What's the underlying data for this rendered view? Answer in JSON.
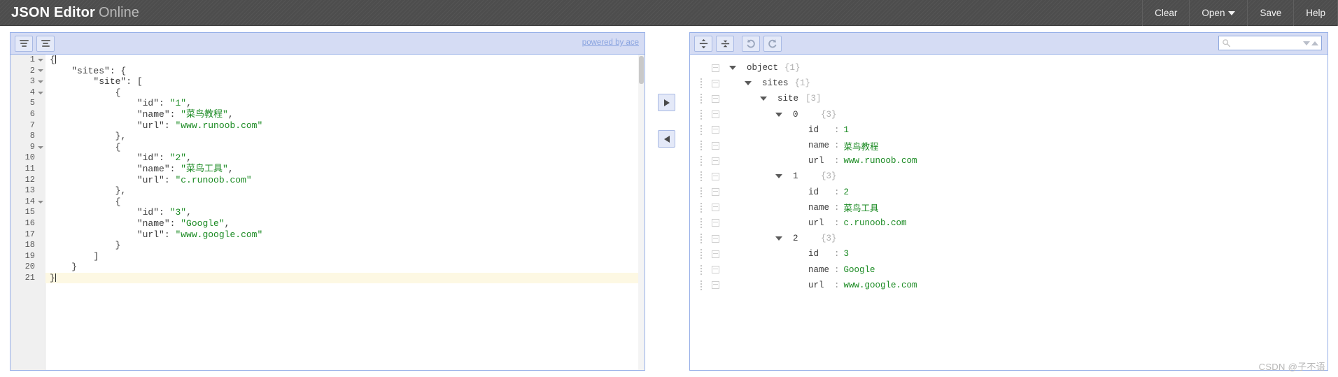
{
  "header": {
    "brand_strong": "JSON Editor",
    "brand_light": "Online",
    "menu": [
      {
        "label": "Clear",
        "icon": "",
        "has_caret": false
      },
      {
        "label": "Open",
        "icon": "chevron-down-icon",
        "has_caret": true
      },
      {
        "label": "Save",
        "icon": "",
        "has_caret": false
      },
      {
        "label": "Help",
        "icon": "",
        "has_caret": false
      }
    ]
  },
  "code_editor": {
    "toolbar": {
      "format_button": "format-json",
      "compact_button": "compact-json",
      "powered_by": "powered by ace"
    },
    "lines": [
      {
        "num": "1",
        "fold": true,
        "text": "{",
        "active": false,
        "caret": true
      },
      {
        "num": "2",
        "fold": true,
        "text": "    \"sites\": {",
        "active": false,
        "caret": false
      },
      {
        "num": "3",
        "fold": true,
        "text": "        \"site\": [",
        "active": false,
        "caret": false
      },
      {
        "num": "4",
        "fold": true,
        "text": "            {",
        "active": false,
        "caret": false
      },
      {
        "num": "5",
        "fold": false,
        "text": "                \"id\": \"1\",",
        "active": false,
        "caret": false
      },
      {
        "num": "6",
        "fold": false,
        "text": "                \"name\": \"菜鸟教程\",",
        "active": false,
        "caret": false
      },
      {
        "num": "7",
        "fold": false,
        "text": "                \"url\": \"www.runoob.com\"",
        "active": false,
        "caret": false
      },
      {
        "num": "8",
        "fold": false,
        "text": "            },",
        "active": false,
        "caret": false
      },
      {
        "num": "9",
        "fold": true,
        "text": "            {",
        "active": false,
        "caret": false
      },
      {
        "num": "10",
        "fold": false,
        "text": "                \"id\": \"2\",",
        "active": false,
        "caret": false
      },
      {
        "num": "11",
        "fold": false,
        "text": "                \"name\": \"菜鸟工具\",",
        "active": false,
        "caret": false
      },
      {
        "num": "12",
        "fold": false,
        "text": "                \"url\": \"c.runoob.com\"",
        "active": false,
        "caret": false
      },
      {
        "num": "13",
        "fold": false,
        "text": "            },",
        "active": false,
        "caret": false
      },
      {
        "num": "14",
        "fold": true,
        "text": "            {",
        "active": false,
        "caret": false
      },
      {
        "num": "15",
        "fold": false,
        "text": "                \"id\": \"3\",",
        "active": false,
        "caret": false
      },
      {
        "num": "16",
        "fold": false,
        "text": "                \"name\": \"Google\",",
        "active": false,
        "caret": false
      },
      {
        "num": "17",
        "fold": false,
        "text": "                \"url\": \"www.google.com\"",
        "active": false,
        "caret": false
      },
      {
        "num": "18",
        "fold": false,
        "text": "            }",
        "active": false,
        "caret": false
      },
      {
        "num": "19",
        "fold": false,
        "text": "        ]",
        "active": false,
        "caret": false
      },
      {
        "num": "20",
        "fold": false,
        "text": "    }",
        "active": false,
        "caret": false
      },
      {
        "num": "21",
        "fold": false,
        "text": "}",
        "active": true,
        "caret": true
      }
    ]
  },
  "transfer": {
    "to_tree_label": "transfer-right",
    "to_code_label": "transfer-left"
  },
  "tree_editor": {
    "toolbar": {
      "expand_all": "expand-all",
      "collapse_all": "collapse-all",
      "undo": "undo",
      "redo": "redo"
    },
    "search": {
      "value": "",
      "placeholder": ""
    },
    "rows": [
      {
        "indent": 0,
        "expander": true,
        "key": "object",
        "type": "{1}",
        "value": "",
        "root": true
      },
      {
        "indent": 1,
        "expander": true,
        "key": "sites",
        "type": "{1}",
        "value": "",
        "root": false
      },
      {
        "indent": 2,
        "expander": true,
        "key": "site",
        "type": "[3]",
        "value": "",
        "root": false
      },
      {
        "indent": 3,
        "expander": true,
        "key": "0",
        "type": "{3}",
        "value": "",
        "root": false
      },
      {
        "indent": 4,
        "expander": false,
        "key": "id",
        "type": "",
        "value": "1",
        "root": false
      },
      {
        "indent": 4,
        "expander": false,
        "key": "name",
        "type": "",
        "value": "菜鸟教程",
        "root": false
      },
      {
        "indent": 4,
        "expander": false,
        "key": "url",
        "type": "",
        "value": "www.runoob.com",
        "root": false
      },
      {
        "indent": 3,
        "expander": true,
        "key": "1",
        "type": "{3}",
        "value": "",
        "root": false
      },
      {
        "indent": 4,
        "expander": false,
        "key": "id",
        "type": "",
        "value": "2",
        "root": false
      },
      {
        "indent": 4,
        "expander": false,
        "key": "name",
        "type": "",
        "value": "菜鸟工具",
        "root": false
      },
      {
        "indent": 4,
        "expander": false,
        "key": "url",
        "type": "",
        "value": "c.runoob.com",
        "root": false
      },
      {
        "indent": 3,
        "expander": true,
        "key": "2",
        "type": "{3}",
        "value": "",
        "root": false
      },
      {
        "indent": 4,
        "expander": false,
        "key": "id",
        "type": "",
        "value": "3",
        "root": false
      },
      {
        "indent": 4,
        "expander": false,
        "key": "name",
        "type": "",
        "value": "Google",
        "root": false
      },
      {
        "indent": 4,
        "expander": false,
        "key": "url",
        "type": "",
        "value": "www.google.com",
        "root": false
      }
    ],
    "separator": ":"
  },
  "watermark": "CSDN @子不语",
  "colors": {
    "header_bg": "#4d4d4d",
    "toolbar_bg": "#d5dcf4",
    "pane_border": "#97b0e8",
    "string_value": "#1a8a22",
    "active_line": "#fdf8e3",
    "link": "#8aa4e0"
  }
}
